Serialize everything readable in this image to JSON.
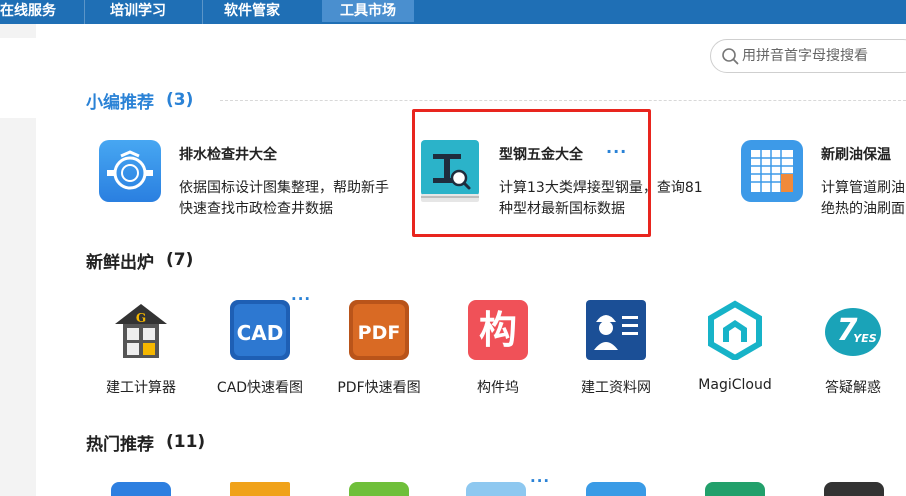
{
  "nav": {
    "tabs": [
      {
        "label": "在线服务",
        "active": false
      },
      {
        "label": "培训学习",
        "active": false
      },
      {
        "label": "软件管家",
        "active": false
      },
      {
        "label": "工具市场",
        "active": true
      }
    ]
  },
  "search": {
    "placeholder": "用拼音首字母搜搜看",
    "value": ""
  },
  "sections": {
    "editor_pick": {
      "title": "小编推荐",
      "count": "(3)"
    },
    "new": {
      "title": "新鲜出炉",
      "count": "(7)"
    },
    "hot": {
      "title": "热门推荐",
      "count": "(11)"
    }
  },
  "recommendations": [
    {
      "name": "排水检查井大全",
      "desc": "依据国标设计图集整理，帮助新手快速查找市政检查井数据",
      "icon": "manhole-icon"
    },
    {
      "name": "型钢五金大全",
      "desc": "计算13大类焊接型钢量，查询81种型材最新国标数据",
      "icon": "steel-book-icon",
      "more": "···",
      "highlighted": true
    },
    {
      "name": "新刷油保温",
      "desc": "计算管道刷油绝热的油刷面",
      "icon": "spreadsheet-grid-icon"
    }
  ],
  "new_apps": [
    {
      "name": "建工计算器",
      "icon": "calculator-icon"
    },
    {
      "name": "CAD快速看图",
      "icon": "cad-icon",
      "more": "···"
    },
    {
      "name": "PDF快速看图",
      "icon": "pdf-icon"
    },
    {
      "name": "构件坞",
      "icon": "gouj-icon",
      "glyph": "构"
    },
    {
      "name": "建工资料网",
      "icon": "worker-id-icon"
    },
    {
      "name": "MagiCloud",
      "icon": "magicloud-icon"
    },
    {
      "name": "答疑解惑",
      "icon": "yes-icon"
    }
  ],
  "colors": {
    "nav_bg": "#1f6fb5",
    "accent": "#2a82d6",
    "highlight": "#e8251e"
  }
}
